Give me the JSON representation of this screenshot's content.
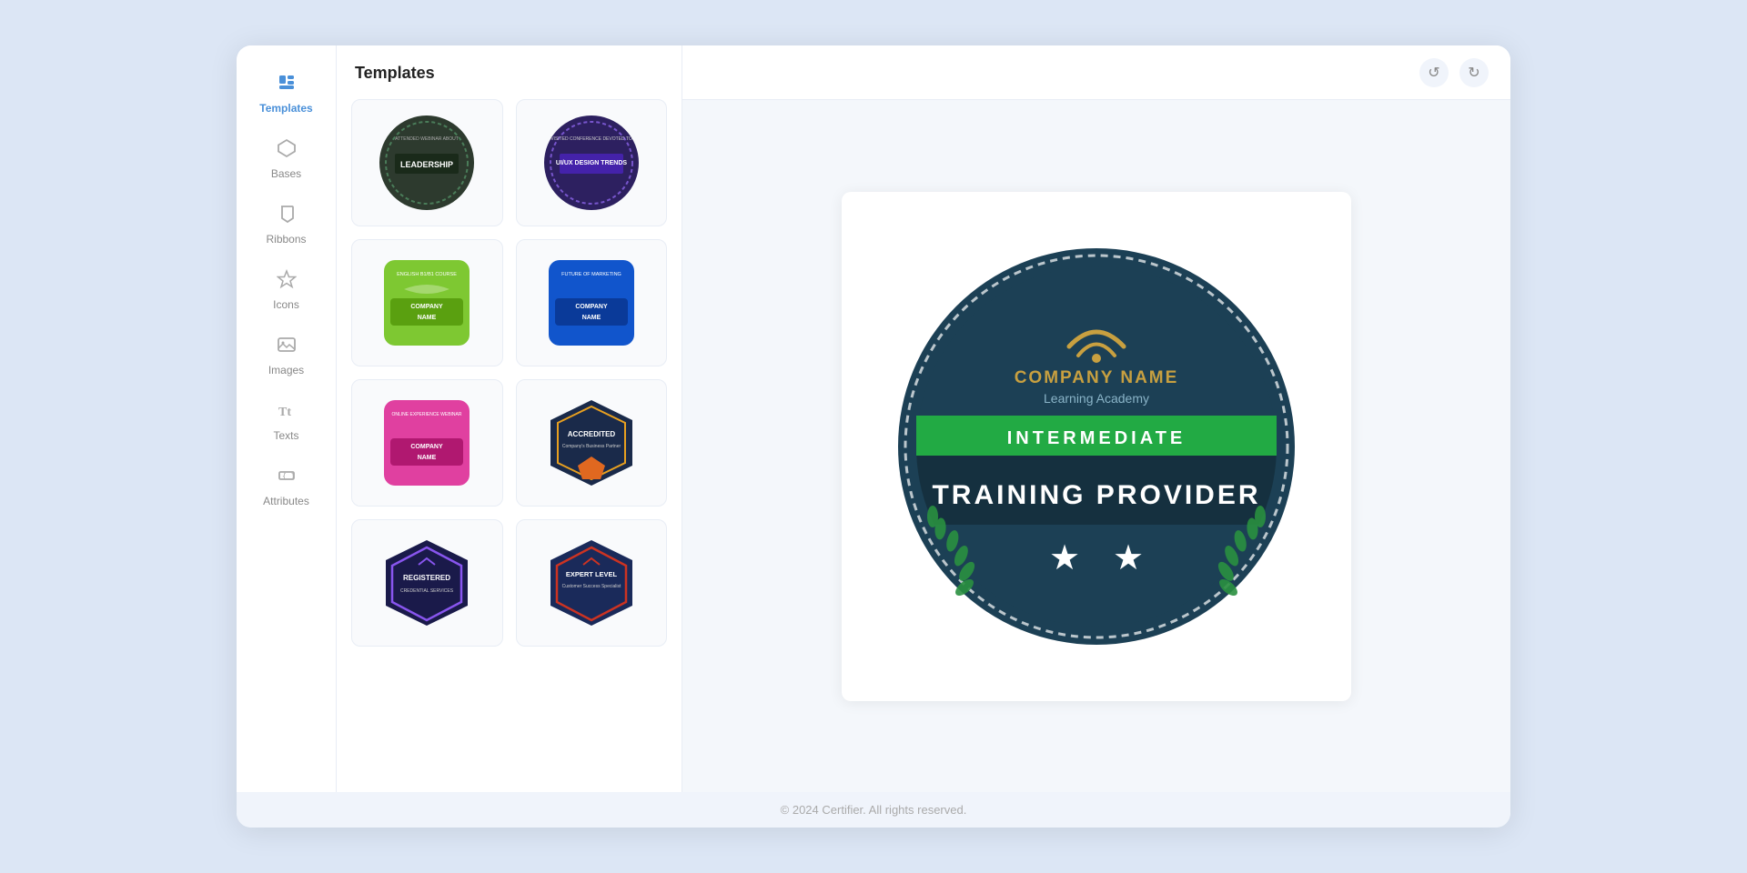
{
  "sidebar": {
    "items": [
      {
        "id": "templates",
        "label": "Templates",
        "icon": "📄",
        "active": true
      },
      {
        "id": "bases",
        "label": "Bases",
        "icon": "⬡",
        "active": false
      },
      {
        "id": "ribbons",
        "label": "Ribbons",
        "icon": "🔖",
        "active": false
      },
      {
        "id": "icons",
        "label": "Icons",
        "icon": "☆",
        "active": false
      },
      {
        "id": "images",
        "label": "Images",
        "icon": "🖼",
        "active": false
      },
      {
        "id": "texts",
        "label": "Texts",
        "icon": "Tt",
        "active": false
      },
      {
        "id": "attributes",
        "label": "Attributes",
        "icon": "[]",
        "active": false
      }
    ]
  },
  "templates_panel": {
    "title": "Templates",
    "templates": [
      {
        "id": 1,
        "name": "leadership-badge"
      },
      {
        "id": 2,
        "name": "ui-ux-design-badge"
      },
      {
        "id": 3,
        "name": "english-course-badge"
      },
      {
        "id": 4,
        "name": "future-marketing-badge"
      },
      {
        "id": 5,
        "name": "online-experience-badge"
      },
      {
        "id": 6,
        "name": "accredited-badge"
      },
      {
        "id": 7,
        "name": "registered-badge"
      },
      {
        "id": 8,
        "name": "expert-level-badge"
      }
    ]
  },
  "preview": {
    "badge": {
      "company_name": "COMPANY NAME",
      "academy": "Learning Academy",
      "level": "INTERMEDIATE",
      "title": "TRAINING PROVIDER",
      "stars": 2
    }
  },
  "toolbar": {
    "undo_label": "↺",
    "redo_label": "↻"
  },
  "footer": {
    "text": "© 2024 Certifier. All rights reserved."
  }
}
